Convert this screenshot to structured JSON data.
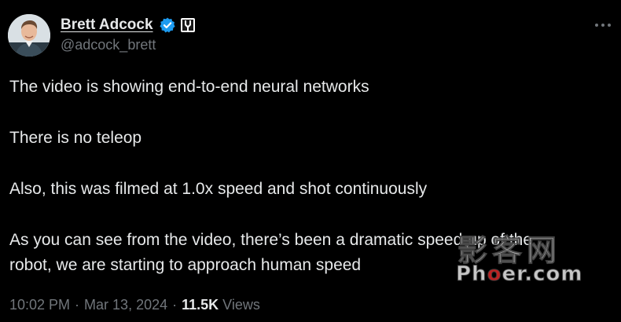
{
  "author": {
    "display_name": "Brett Adcock",
    "handle": "@adcock_brett",
    "avatar_icon": "profile-photo",
    "verified_icon": "verified-badge-icon",
    "verified_color": "#1d9bf0",
    "org_icon": "organization-badge-icon"
  },
  "tweet": {
    "paragraphs": [
      "The video is showing end-to-end neural networks",
      "There is no teleop",
      "Also, this was filmed at 1.0x speed and shot continuously",
      "As you can see from the video, there’s been a dramatic speed-up of the",
      "robot, we are starting to approach human speed"
    ]
  },
  "meta": {
    "time": "10:02 PM",
    "separator": "·",
    "date": "Mar 13, 2024",
    "views_count": "11.5K",
    "views_label": "Views"
  },
  "watermark": {
    "cn_text": "影客网",
    "en_prefix": "Ph",
    "en_highlight": "o",
    "en_suffix": "er.com"
  },
  "more_icon": "ellipsis-icon",
  "colors": {
    "background": "#000000",
    "primary_text": "#e7e9ea",
    "secondary_text": "#71767b"
  }
}
